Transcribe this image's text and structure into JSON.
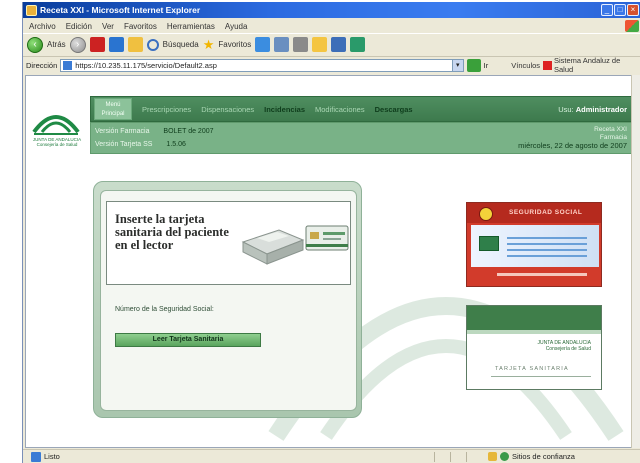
{
  "window": {
    "title": "Receta XXI - Microsoft Internet Explorer",
    "min": "_",
    "max": "□",
    "close": "×"
  },
  "menu": [
    "Archivo",
    "Edición",
    "Ver",
    "Favoritos",
    "Herramientas",
    "Ayuda"
  ],
  "toolbar": {
    "back": "Atrás",
    "search": "Búsqueda",
    "favorites": "Favoritos"
  },
  "address": {
    "label": "Dirección",
    "url": "https://10.235.11.175/servicio/Default2.asp",
    "go": "Ir",
    "links": "Vínculos",
    "brand": "Sistema Andaluz de Salud"
  },
  "app": {
    "logo_text": "JUNTA DE ANDALUCIA\nConsejería de Salud",
    "nav": {
      "start": "Menú Principal",
      "items": [
        "Prescripciones",
        "Dispensaciones",
        "Incidencias",
        "Modificaciones",
        "Descargas"
      ],
      "active": "Incidencias",
      "user_label": "Usu:",
      "user_name": "Administrador"
    },
    "info": {
      "row1_label": "Versión Farmacia",
      "row1_value": "BOLET de 2007",
      "row2_label": "Versión Tarjeta SS",
      "row2_value": "1.5.06",
      "right_top": "Receta XXI",
      "right_mid": "Farmacia",
      "date": "miércoles, 22 de agosto de 2007"
    }
  },
  "main": {
    "insert_text": "Inserte la tarjeta sanitaria del paciente en el lector",
    "ss_number_label": "Número de la Seguridad Social:",
    "read_button": "Leer Tarjeta Sanitaria"
  },
  "cards": {
    "ss_title": "SEGURIDAD SOCIAL",
    "sanitaria_org": "JUNTA DE ANDALUCIA\nConsejería de Salud",
    "sanitaria_label": "TARJETA SANITARIA"
  },
  "status": {
    "text": "Listo",
    "zone": "Sitios de confianza"
  }
}
